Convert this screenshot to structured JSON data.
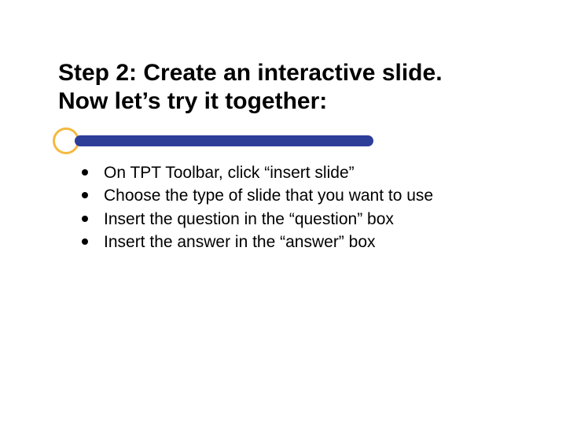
{
  "title_line1": "Step 2: Create an interactive slide.",
  "title_line2": "Now let’s try it together:",
  "bullets": [
    "On TPT Toolbar, click “insert slide”",
    "Choose the type of slide that you want to use",
    "Insert the question in the “question” box",
    "Insert the answer in the “answer” box"
  ],
  "colors": {
    "accent_circle": "#f4b93f",
    "accent_bar": "#2d3e99"
  }
}
